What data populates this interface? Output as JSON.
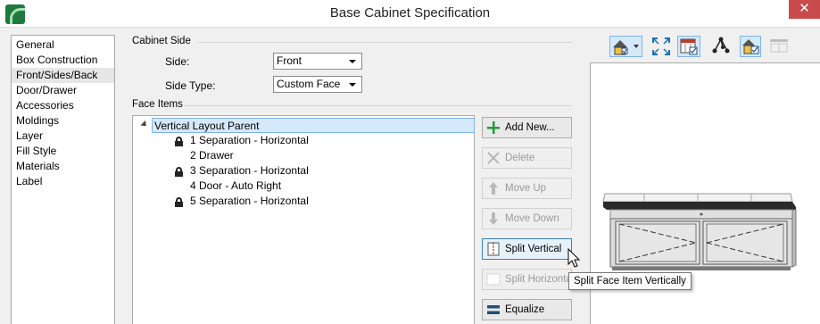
{
  "window": {
    "title": "Base Cabinet Specification",
    "close_glyph": "✕"
  },
  "nav": {
    "items": [
      "General",
      "Box Construction",
      "Front/Sides/Back",
      "Door/Drawer",
      "Accessories",
      "Moldings",
      "Layer",
      "Fill Style",
      "Materials",
      "Label"
    ],
    "selected_index": 2
  },
  "cabinet_side": {
    "group_label": "Cabinet Side",
    "side_label": "Side:",
    "side_value": "Front",
    "side_type_label": "Side Type:",
    "side_type_value": "Custom Face"
  },
  "face_items": {
    "group_label": "Face Items",
    "root": "Vertical Layout Parent",
    "children": [
      {
        "label": "1 Separation - Horizontal",
        "locked": true
      },
      {
        "label": "2 Drawer",
        "locked": false
      },
      {
        "label": "3 Separation - Horizontal",
        "locked": true
      },
      {
        "label": "4 Door - Auto Right",
        "locked": false
      },
      {
        "label": "5 Separation - Horizontal",
        "locked": true
      }
    ]
  },
  "buttons": {
    "add_new": "Add New...",
    "delete": "Delete",
    "move_up": "Move Up",
    "move_down": "Move Down",
    "split_vertical": "Split Vertical",
    "split_horizontal": "Split Horizontal",
    "equalize": "Equalize"
  },
  "tooltip": "Split Face Item Vertically",
  "toolbar": {
    "icons": [
      "view-mode-icon",
      "fill-window-icon",
      "color-on-off-icon",
      "camera-options-icon",
      "show-layout-icon",
      "toggle-grid-icon"
    ]
  },
  "colors": {
    "selection": "#d6e9fb",
    "selection_border": "#7eb4ea",
    "add_green": "#1e9c3c",
    "equalize_blue": "#1f4e79"
  }
}
